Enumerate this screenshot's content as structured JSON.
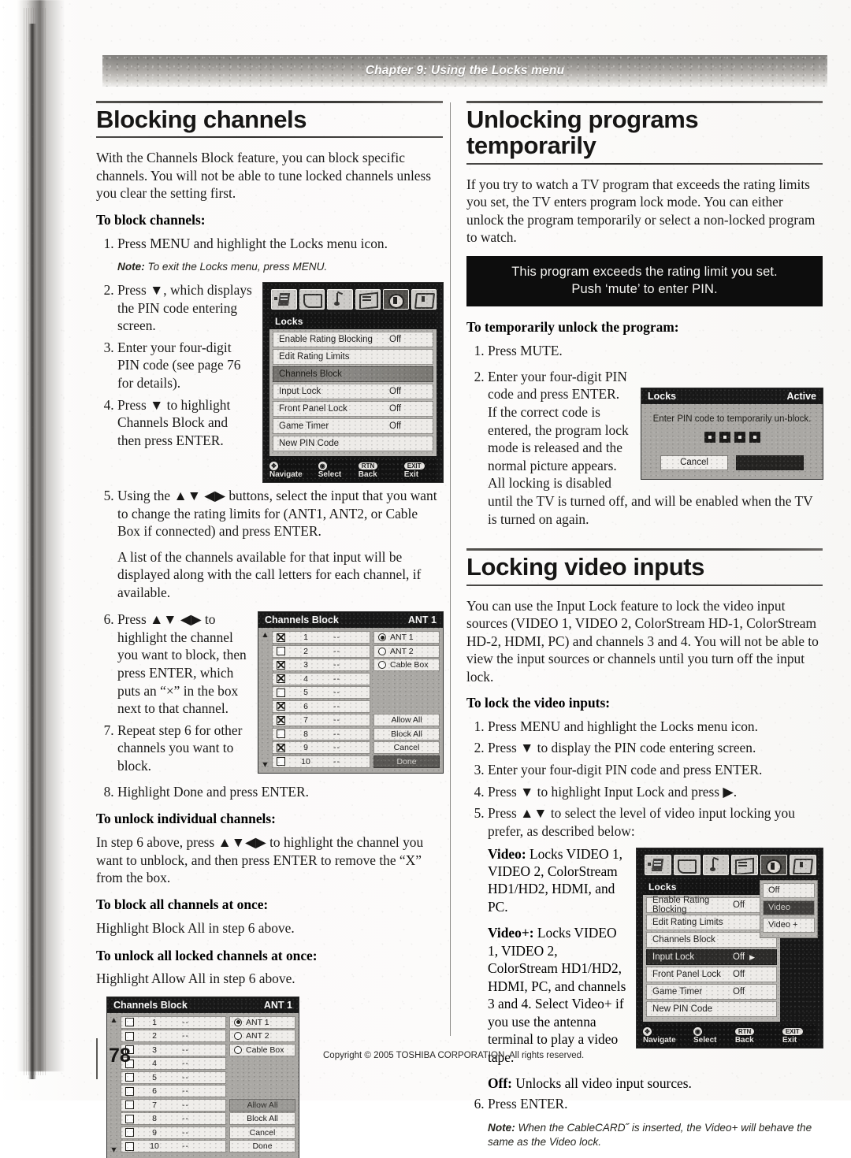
{
  "page": {
    "running_header": "Chapter 9: Using the Locks menu",
    "page_number": "78",
    "copyright": "Copyright © 2005 TOSHIBA CORPORATION. All rights reserved."
  },
  "left_column": {
    "heading": "Blocking channels",
    "intro": "With the Channels Block feature, you can block specific channels. You will not be able to tune locked channels unless you clear the setting first.",
    "proc1_heading": "To block channels:",
    "proc1_steps": [
      "Press MENU and highlight the Locks menu icon.",
      "Press ▼, which displays the PIN code entering screen.",
      "Enter your four-digit PIN code (see page 76 for details).",
      "Press ▼ to highlight Channels Block and then press ENTER.",
      "Using the ▲▼ ◀▶ buttons, select the input that you want to change the rating limits for (ANT1, ANT2, or Cable Box if connected) and press ENTER.",
      "Press ▲▼ ◀▶ to highlight the channel you want to block, then press ENTER, which puts an “×” in the box next to that channel.",
      "Repeat step 6 for other channels you want to block.",
      "Highlight Done and press ENTER."
    ],
    "note1_label": "Note:",
    "note1_text": "To exit the Locks menu, press MENU.",
    "step5_followup": "A list of the channels available for that input will be displayed along with the call letters for each channel, if available.",
    "proc2_heading": "To unlock individual channels:",
    "proc2_text": "In step 6 above, press ▲▼◀▶ to highlight the channel you want to unblock, and then press ENTER to remove the “X” from the box.",
    "proc3_heading": "To block all channels at once:",
    "proc3_text": "Highlight Block All in step 6 above.",
    "proc4_heading": "To unlock all locked channels at once:",
    "proc4_text": "Highlight Allow All in step 6 above."
  },
  "right_column": {
    "heading1": "Unlocking programs temporarily",
    "intro1": "If you try to watch a TV program that exceeds the rating limits you set, the TV enters program lock mode. You can either unlock the program temporarily or select a non-locked program to watch.",
    "tv_message_line1": "This program exceeds the rating limit you set.",
    "tv_message_line2": "Push ‘mute’ to enter PIN.",
    "proc1_heading": "To temporarily unlock the program:",
    "proc1_steps": [
      "Press MUTE.",
      "Enter your four-digit PIN code and press ENTER. If the correct code is entered, the program lock mode is released and the normal picture appears. All locking is disabled until the TV is turned off, and will be enabled when the TV is turned on again."
    ],
    "heading2": "Locking video inputs",
    "intro2": "You can use the Input Lock feature to lock the video input sources (VIDEO 1, VIDEO 2, ColorStream HD-1, ColorStream HD-2, HDMI, PC) and channels 3 and 4. You will not be able to view the input sources or channels until you turn off the input lock.",
    "proc2_heading": "To lock the video inputs:",
    "proc2_steps": [
      "Press MENU and highlight the Locks menu icon.",
      "Press ▼ to display the PIN code entering screen.",
      "Enter your four-digit PIN code and press ENTER.",
      "Press ▼ to highlight Input Lock and press ▶.",
      "Press ▲▼ to select the level of video input locking you prefer, as described below:",
      "Press ENTER."
    ],
    "definitions": [
      {
        "term": "Video:",
        "text": " Locks VIDEO 1, VIDEO 2, ColorStream HD1/HD2, HDMI, and PC."
      },
      {
        "term": "Video+:",
        "text": " Locks VIDEO 1, VIDEO 2, ColorStream HD1/HD2, HDMI, PC, and channels 3 and 4. Select Video+ if you use the antenna terminal to play a video tape."
      },
      {
        "term": "Off:",
        "text": " Unlocks all video input sources."
      }
    ],
    "note_label": "Note:",
    "note_text": "When the CableCARD˝ is inserted, the Video+ will behave the same as the Video lock."
  },
  "osd_locks_menu_1": {
    "title": "Locks",
    "status": "",
    "icons": [
      "antenna-icon",
      "picture-icon",
      "audio-icon",
      "settings-icon",
      "locks-icon",
      "setup-icon"
    ],
    "selected_icon_index": 4,
    "rows": [
      {
        "label": "Enable Rating Blocking",
        "value": "Off",
        "state": "normal"
      },
      {
        "label": "Edit Rating Limits",
        "value": "",
        "state": "normal"
      },
      {
        "label": "Channels Block",
        "value": "",
        "state": "highlighted"
      },
      {
        "label": "Input Lock",
        "value": "Off",
        "state": "normal"
      },
      {
        "label": "Front Panel Lock",
        "value": "Off",
        "state": "normal"
      },
      {
        "label": "Game Timer",
        "value": "Off",
        "state": "normal"
      },
      {
        "label": "New PIN Code",
        "value": "",
        "state": "normal"
      }
    ],
    "nav": [
      {
        "key": "✥",
        "label": "Navigate"
      },
      {
        "key": "◉",
        "label": "Select"
      },
      {
        "key": "RTN",
        "label": "Back"
      },
      {
        "key": "EXIT",
        "label": "Exit"
      }
    ]
  },
  "osd_locks_menu_2": {
    "title": "Locks",
    "rows": [
      {
        "label": "Enable Rating Blocking",
        "value": "Off",
        "state": "normal"
      },
      {
        "label": "Edit Rating Limits",
        "value": "",
        "state": "normal"
      },
      {
        "label": "Channels Block",
        "value": "",
        "state": "normal"
      },
      {
        "label": "Input Lock",
        "value": "Off",
        "state": "highlighted",
        "caret": "▶"
      },
      {
        "label": "Front Panel Lock",
        "value": "Off",
        "state": "normal"
      },
      {
        "label": "Game Timer",
        "value": "Off",
        "state": "normal"
      },
      {
        "label": "New PIN Code",
        "value": "",
        "state": "normal"
      }
    ],
    "submenu": [
      {
        "label": "Off",
        "state": "normal"
      },
      {
        "label": "Video",
        "state": "highlighted"
      },
      {
        "label": "Video +",
        "state": "normal"
      }
    ],
    "nav": [
      {
        "key": "✥",
        "label": "Navigate"
      },
      {
        "key": "◉",
        "label": "Select"
      },
      {
        "key": "RTN",
        "label": "Back"
      },
      {
        "key": "EXIT",
        "label": "Exit"
      }
    ]
  },
  "osd_channels_block_1": {
    "title": "Channels Block",
    "input": "ANT 1",
    "columns": [
      "blocked",
      "channel",
      "call_letters"
    ],
    "rows": [
      {
        "blocked": true,
        "channel": "1",
        "call": "--"
      },
      {
        "blocked": false,
        "channel": "2",
        "call": "--"
      },
      {
        "blocked": true,
        "channel": "3",
        "call": "--"
      },
      {
        "blocked": true,
        "channel": "4",
        "call": "--"
      },
      {
        "blocked": false,
        "channel": "5",
        "call": "--"
      },
      {
        "blocked": true,
        "channel": "6",
        "call": "--"
      },
      {
        "blocked": true,
        "channel": "7",
        "call": "--"
      },
      {
        "blocked": false,
        "channel": "8",
        "call": "--"
      },
      {
        "blocked": true,
        "channel": "9",
        "call": "--"
      },
      {
        "blocked": false,
        "channel": "10",
        "call": "--"
      }
    ],
    "inputs": [
      {
        "label": "ANT 1",
        "selected": true
      },
      {
        "label": "ANT 2",
        "selected": false
      },
      {
        "label": "Cable Box",
        "selected": false
      }
    ],
    "buttons": [
      {
        "label": "Allow All",
        "state": "normal"
      },
      {
        "label": "Block All",
        "state": "normal"
      },
      {
        "label": "Cancel",
        "state": "normal"
      },
      {
        "label": "Done",
        "state": "highlighted"
      }
    ]
  },
  "osd_channels_block_2": {
    "title": "Channels Block",
    "input": "ANT 1",
    "rows": [
      {
        "blocked": false,
        "channel": "1",
        "call": "--"
      },
      {
        "blocked": false,
        "channel": "2",
        "call": "--"
      },
      {
        "blocked": false,
        "channel": "3",
        "call": "--"
      },
      {
        "blocked": false,
        "channel": "4",
        "call": "--"
      },
      {
        "blocked": false,
        "channel": "5",
        "call": "--"
      },
      {
        "blocked": false,
        "channel": "6",
        "call": "--"
      },
      {
        "blocked": false,
        "channel": "7",
        "call": "--"
      },
      {
        "blocked": false,
        "channel": "8",
        "call": "--"
      },
      {
        "blocked": false,
        "channel": "9",
        "call": "--"
      },
      {
        "blocked": false,
        "channel": "10",
        "call": "--"
      }
    ],
    "inputs": [
      {
        "label": "ANT 1",
        "selected": true
      },
      {
        "label": "ANT 2",
        "selected": false
      },
      {
        "label": "Cable Box",
        "selected": false
      }
    ],
    "buttons": [
      {
        "label": "Allow All",
        "state": "highlighted"
      },
      {
        "label": "Block All",
        "state": "normal"
      },
      {
        "label": "Cancel",
        "state": "normal"
      },
      {
        "label": "Done",
        "state": "normal"
      }
    ]
  },
  "osd_pin_dialog": {
    "title": "Locks",
    "status": "Active",
    "message": "Enter PIN code to temporarily un-block.",
    "digits": [
      "▪",
      "▪",
      "▪",
      "▪"
    ],
    "buttons": [
      {
        "label": "Cancel",
        "state": "normal"
      },
      {
        "label": "",
        "state": "dark"
      }
    ]
  },
  "colors": {
    "osd_black": "#0d0d0d",
    "osd_gray": "#a9a7a3",
    "osd_row": "#f1efec",
    "ink": "#1a1918"
  }
}
